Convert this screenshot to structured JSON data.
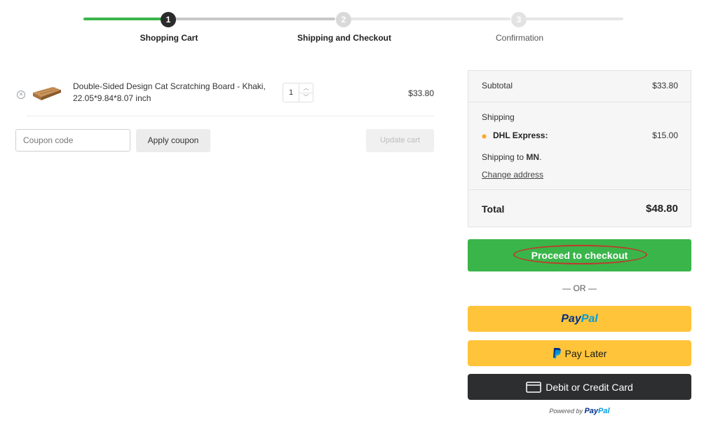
{
  "steps": [
    {
      "number": "1",
      "label": "Shopping Cart",
      "state": "active"
    },
    {
      "number": "2",
      "label": "Shipping and Checkout",
      "state": "upcoming"
    },
    {
      "number": "3",
      "label": "Confirmation",
      "state": "upcoming"
    }
  ],
  "colors": {
    "progress_green": "#3ab54a",
    "checkout_green": "#3ab54a",
    "paypal_yellow": "#ffc439",
    "card_dark": "#2c2e2f",
    "highlight_red": "#c0392b"
  },
  "cart": {
    "item": {
      "name": "Double-Sided Design Cat Scratching Board - Khaki, 22.05*9.84*8.07 inch",
      "quantity": "1",
      "price": "$33.80",
      "remove_icon": "close-circle-icon"
    },
    "coupon_placeholder": "Coupon code",
    "apply_coupon_label": "Apply coupon",
    "update_cart_label": "Update cart"
  },
  "totals": {
    "subtotal_label": "Subtotal",
    "subtotal_value": "$33.80",
    "shipping_label": "Shipping",
    "shipping_method": "DHL Express:",
    "shipping_cost": "$15.00",
    "shipping_to_prefix": "Shipping to",
    "shipping_to_region": "MN",
    "change_address_label": "Change address",
    "total_label": "Total",
    "total_value": "$48.80"
  },
  "checkout": {
    "proceed_label": "Proceed to checkout",
    "or_label": "— OR —",
    "paypal_pay": "Pay",
    "paypal_pal": "Pal",
    "pay_later_label": "Pay Later",
    "card_label": "Debit or Credit Card",
    "powered_by": "Powered by",
    "powered_pay": "Pay",
    "powered_pal": "Pal"
  }
}
